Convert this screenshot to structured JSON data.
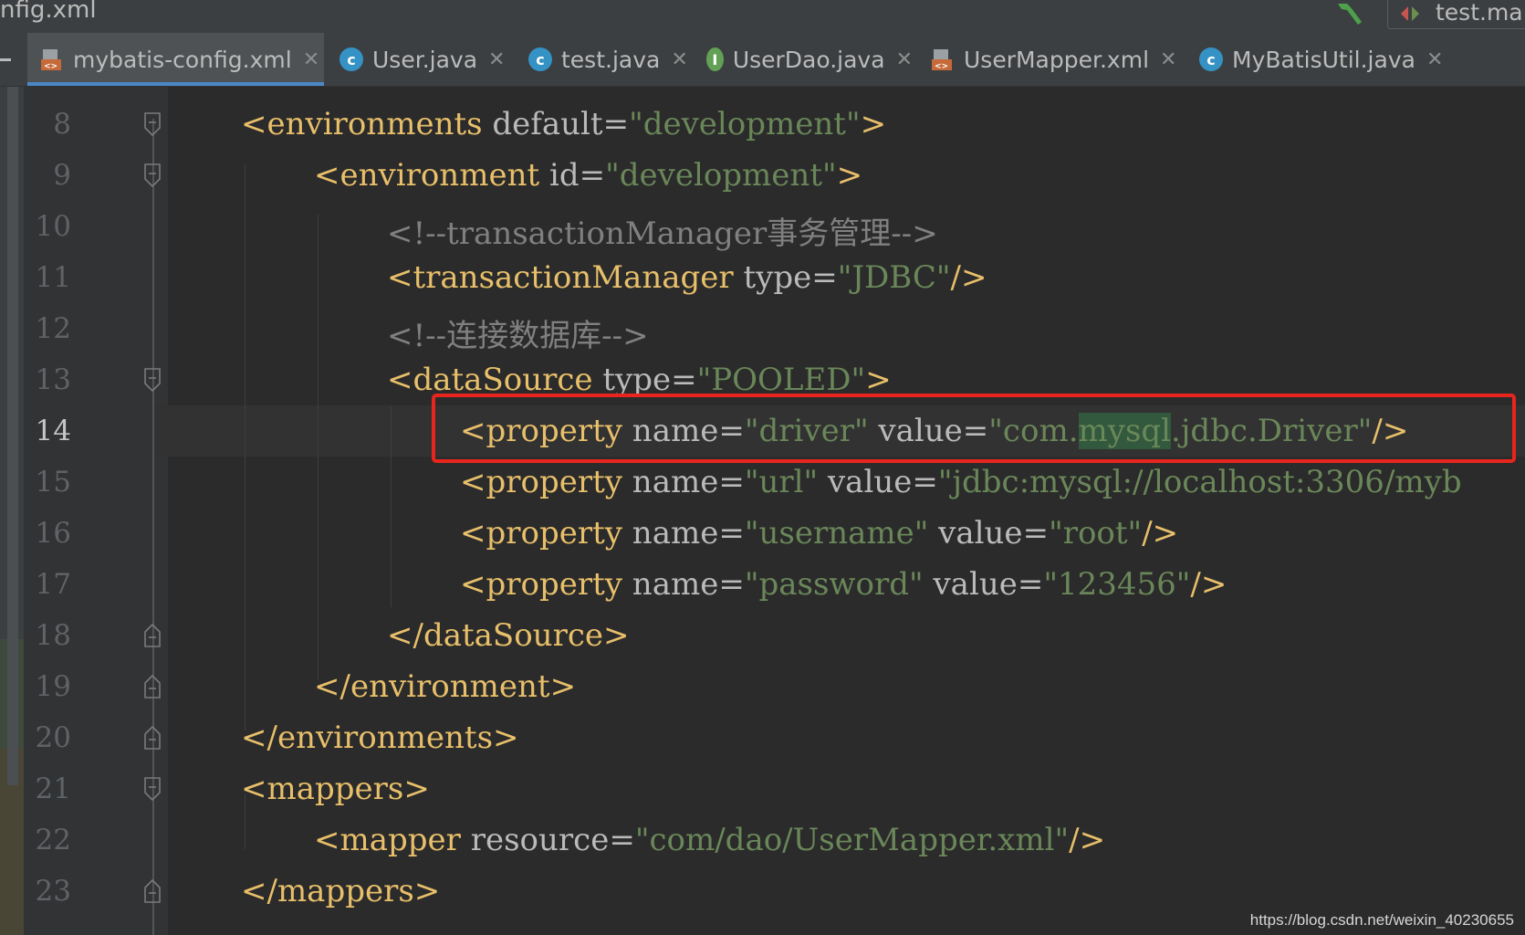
{
  "window": {
    "title_fragment": "nfig.xml",
    "run_config": "test.main"
  },
  "tabs": [
    {
      "label": "mybatis-config.xml",
      "icon": "xml-file-icon",
      "active": true
    },
    {
      "label": "User.java",
      "icon": "class-c-icon",
      "active": false
    },
    {
      "label": "test.java",
      "icon": "class-c-run-icon",
      "active": false
    },
    {
      "label": "UserDao.java",
      "icon": "interface-i-icon",
      "active": false
    },
    {
      "label": "UserMapper.xml",
      "icon": "xml-file-icon",
      "active": false
    },
    {
      "label": "MyBatisUtil.java",
      "icon": "class-c-icon",
      "active": false
    }
  ],
  "editor": {
    "current_line": 14,
    "lines": [
      {
        "num": "8"
      },
      {
        "num": "9"
      },
      {
        "num": "10"
      },
      {
        "num": "11"
      },
      {
        "num": "12"
      },
      {
        "num": "13"
      },
      {
        "num": "14"
      },
      {
        "num": "15"
      },
      {
        "num": "16"
      },
      {
        "num": "17"
      },
      {
        "num": "18"
      },
      {
        "num": "19"
      },
      {
        "num": "20"
      },
      {
        "num": "21"
      },
      {
        "num": "22"
      },
      {
        "num": "23"
      }
    ],
    "code": {
      "l8": {
        "tag": "<environments",
        "attr": " default",
        "eq": "=",
        "val": "\"development\"",
        "end": ">"
      },
      "l9": {
        "tag": "<environment",
        "attr": " id",
        "eq": "=",
        "val": "\"development\"",
        "end": ">"
      },
      "l10": {
        "comment": "<!--transactionManager事务管理-->"
      },
      "l11": {
        "tag": "<transactionManager",
        "attr": " type",
        "eq": "=",
        "val": "\"JDBC\"",
        "end": "/>"
      },
      "l12": {
        "comment": "<!--连接数据库-->"
      },
      "l13": {
        "tag": "<dataSource",
        "attr": " type",
        "eq": "=",
        "val": "\"POOLED\"",
        "end": ">"
      },
      "l14": {
        "tag": "<property",
        "attr1": " name",
        "val1": "\"driver\"",
        "attr2": " value",
        "val2a": "\"com.",
        "val2b": "mysql",
        "val2c": ".jdbc.Driver\"",
        "end": "/>"
      },
      "l15": {
        "tag": "<property",
        "attr1": " name",
        "val1": "\"url\"",
        "attr2": " value",
        "val2": "\"jdbc:mysql://localhost:3306/myb"
      },
      "l16": {
        "tag": "<property",
        "attr1": " name",
        "val1": "\"username\"",
        "attr2": " value",
        "val2": "\"root\"",
        "end": "/>"
      },
      "l17": {
        "tag": "<property",
        "attr1": " name",
        "val1": "\"password\"",
        "attr2": " value",
        "val2": "\"123456\"",
        "end": "/>"
      },
      "l18": {
        "tag": "</dataSource>"
      },
      "l19": {
        "tag": "</environment>"
      },
      "l20": {
        "tag": "</environments>"
      },
      "l21": {
        "tag": "<mappers>"
      },
      "l22": {
        "tag": "<mapper",
        "attr": " resource",
        "eq": "=",
        "val": "\"com/dao/UserMapper.xml\"",
        "end": "/>"
      },
      "l23": {
        "tag": "</mappers>"
      }
    },
    "eq": "="
  },
  "watermark": "https://blog.csdn.net/weixin_40230655"
}
